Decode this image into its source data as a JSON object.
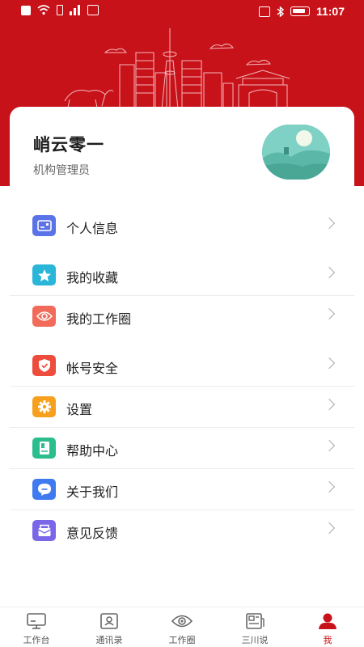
{
  "status_bar": {
    "time": "11:07",
    "left_icons": [
      "alert-icon",
      "wifi-icon",
      "sim-icon",
      "signal-icon",
      "vpn-icon"
    ],
    "right_icons": [
      "nfc-icon",
      "bluetooth-icon",
      "battery-icon"
    ]
  },
  "colors": {
    "brand_red": "#c8121a",
    "icon_personal": "#5b73e8",
    "icon_favorites": "#29b6d8",
    "icon_workcircle": "#f26b5a",
    "icon_security": "#ee4c3c",
    "icon_settings": "#f7a01e",
    "icon_help": "#2bbd8e",
    "icon_about": "#3f7af0",
    "icon_feedback": "#7a67e8"
  },
  "profile": {
    "name": "峭云零一",
    "role": "机构管理员"
  },
  "menu": {
    "items": [
      {
        "label": "个人信息",
        "icon": "id-card-icon"
      },
      {
        "label": "我的收藏",
        "icon": "star-icon"
      },
      {
        "label": "我的工作圈",
        "icon": "eye-icon"
      },
      {
        "label": "帐号安全",
        "icon": "shield-icon"
      },
      {
        "label": "设置",
        "icon": "gear-icon"
      },
      {
        "label": "帮助中心",
        "icon": "help-book-icon"
      },
      {
        "label": "关于我们",
        "icon": "chat-bubble-icon"
      },
      {
        "label": "意见反馈",
        "icon": "mail-box-icon"
      }
    ]
  },
  "tabbar": {
    "tabs": [
      {
        "label": "工作台",
        "icon": "monitor-icon"
      },
      {
        "label": "通讯录",
        "icon": "contacts-icon"
      },
      {
        "label": "工作圈",
        "icon": "eye-icon"
      },
      {
        "label": "三川说",
        "icon": "newspaper-icon"
      },
      {
        "label": "我",
        "icon": "person-icon"
      }
    ],
    "active_index": 4
  }
}
